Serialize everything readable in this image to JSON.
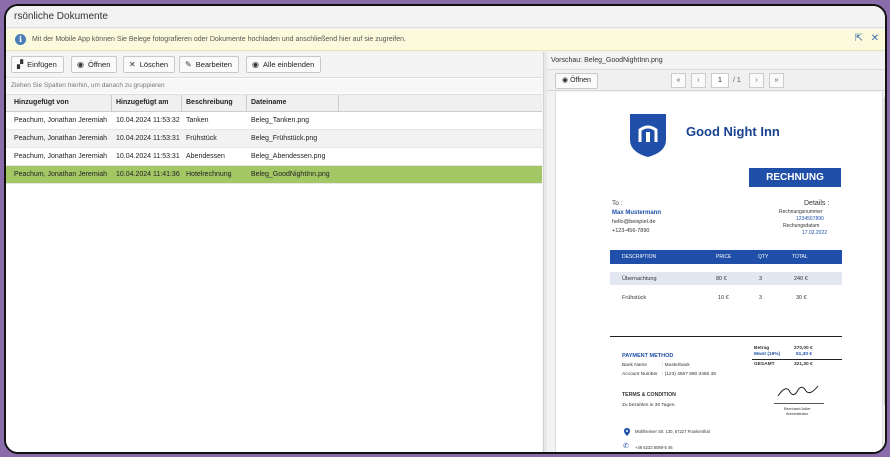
{
  "window": {
    "title": "rsönliche Dokumente"
  },
  "info": {
    "message": "Mit der Mobile App können Sie Belege fotografieren oder Dokumente hochladen und anschließend hier auf sie zugreifen."
  },
  "toolbar": {
    "insert": "Einfügen",
    "open": "Öffnen",
    "delete": "Löschen",
    "edit": "Bearbeiten",
    "show_all": "Alle einblenden"
  },
  "group_hint": "Ziehen Sie Spalten hierhin, um danach zu gruppieren",
  "table": {
    "headers": [
      "Hinzugefügt von",
      "Hinzugefügt am",
      "Beschreibung",
      "Dateiname"
    ],
    "rows": [
      [
        "Peachum, Jonathan Jeremiah",
        "10.04.2024 11:53:32",
        "Tanken",
        "Beleg_Tanken.png"
      ],
      [
        "Peachum, Jonathan Jeremiah",
        "10.04.2024 11:53:31",
        "Frühstück",
        "Beleg_Frühstück.png"
      ],
      [
        "Peachum, Jonathan Jeremiah",
        "10.04.2024 11:53:31",
        "Abendessen",
        "Beleg_Abendessen.png"
      ],
      [
        "Peachum, Jonathan Jeremiah",
        "10.04.2024 11:41:36",
        "Hotelrechnung",
        "Beleg_GoodNightInn.png"
      ]
    ],
    "selected_row": 3
  },
  "preview": {
    "title": "Vorschau: Beleg_GoodNightInn.png",
    "open": "Öffnen",
    "first": "«",
    "prev": "‹",
    "page": "1",
    "of": "/ 1",
    "next": "›",
    "last": "»"
  },
  "invoice": {
    "brand": "Good Night Inn",
    "heading": "RECHNUNG",
    "to_label": "To :",
    "customer": "Max Mustermann",
    "email": "hello@beispiel.de",
    "phone": "+123-456-7890",
    "details_label": "Details :",
    "number_label": "Rechnungsnummer",
    "number": "1234567890",
    "date_label": "Rechungsdatum",
    "date": "17.02.2022",
    "columns": [
      "DESCRIPTION",
      "PRICE",
      "QTY",
      "TOTAL"
    ],
    "items": [
      [
        "Übernachtung",
        "80 €",
        "3",
        "240 €"
      ],
      [
        "Frühstück",
        "10 €",
        "3",
        "30 €"
      ]
    ],
    "amount_label": "Betrag",
    "amount": "270,00 €",
    "vat_label": "Mwst (19%)",
    "vat": "51,30 €",
    "total_label": "GESAMT",
    "total": "321,30 €",
    "payment_heading": "PAYMENT METHOD",
    "bank_label": "Bank Name",
    "bank": ": Musterbank",
    "account_label": "Account Number",
    "account": ": (123) 4567 890 3455 38",
    "terms_heading": "TERMS & CONDITION",
    "terms": "Zu bezahlen in 30 Tagen.",
    "signer": "Bernhard Adler",
    "signer_role": "Administrator",
    "address": "Mühlheimer Str. 130, 67227 Frankenthal",
    "contact_phone": "+49 6233 8080-5 46"
  },
  "colors": {
    "accent": "#1f4fa8",
    "selection": "#a4c766",
    "background": "#8a6cab"
  }
}
